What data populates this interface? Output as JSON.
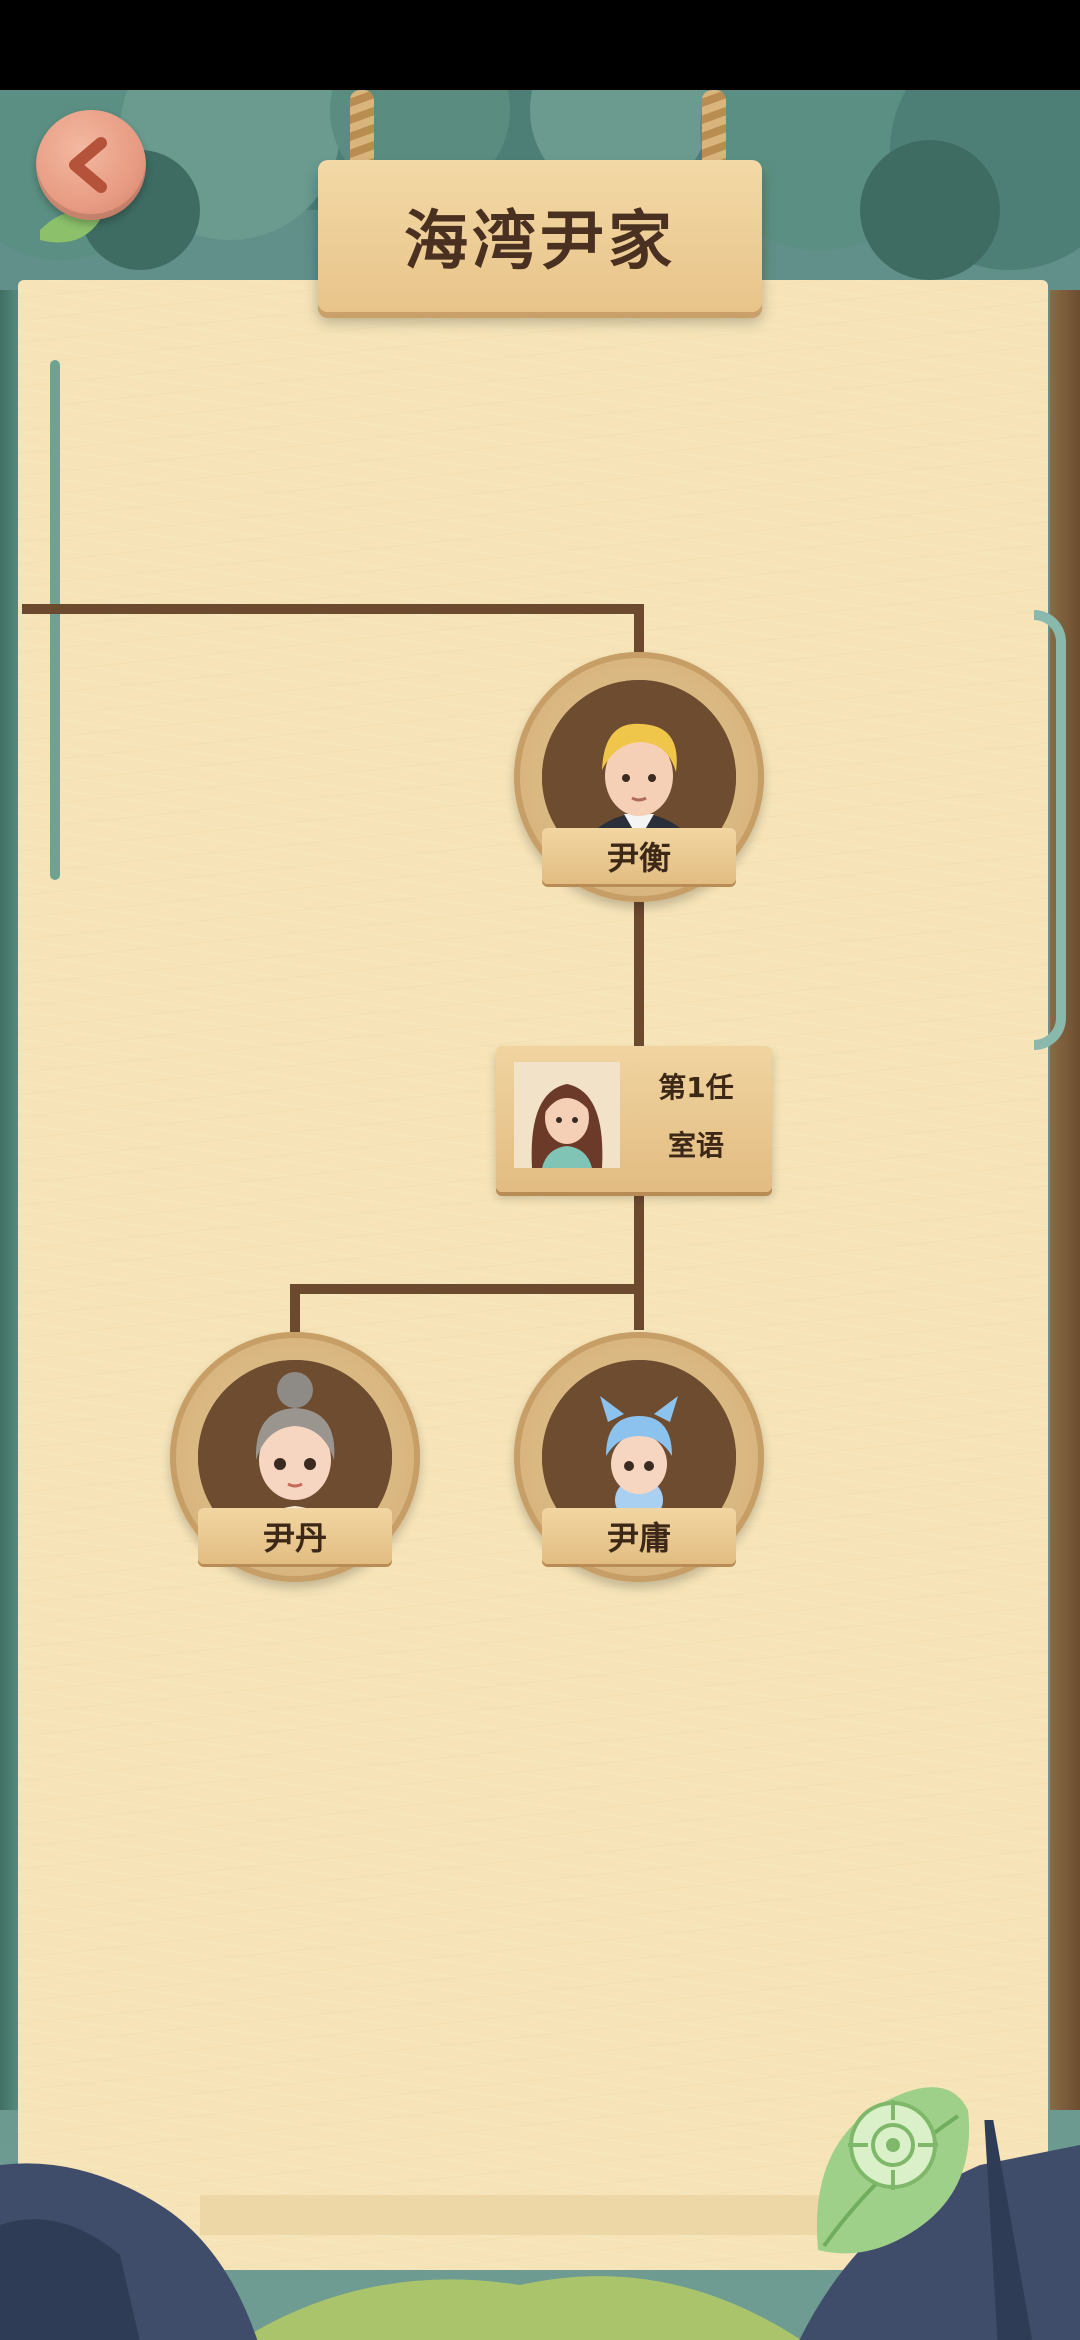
{
  "header": {
    "title": "海湾尹家"
  },
  "tree": {
    "head": {
      "name": "尹衡"
    },
    "spouse": {
      "order": "第1任",
      "name": "室语"
    },
    "children": [
      {
        "name": "尹丹"
      },
      {
        "name": "尹庸"
      }
    ]
  },
  "colors": {
    "parchment": "#f6e4b8",
    "line": "#6b4a2e",
    "wood": "#e2bc82",
    "text": "#3d2818",
    "back_button": "#e79b82",
    "locate_leaf": "#9fd08a"
  },
  "icons": {
    "back": "chevron-left-icon",
    "locate": "crosshair-icon"
  }
}
